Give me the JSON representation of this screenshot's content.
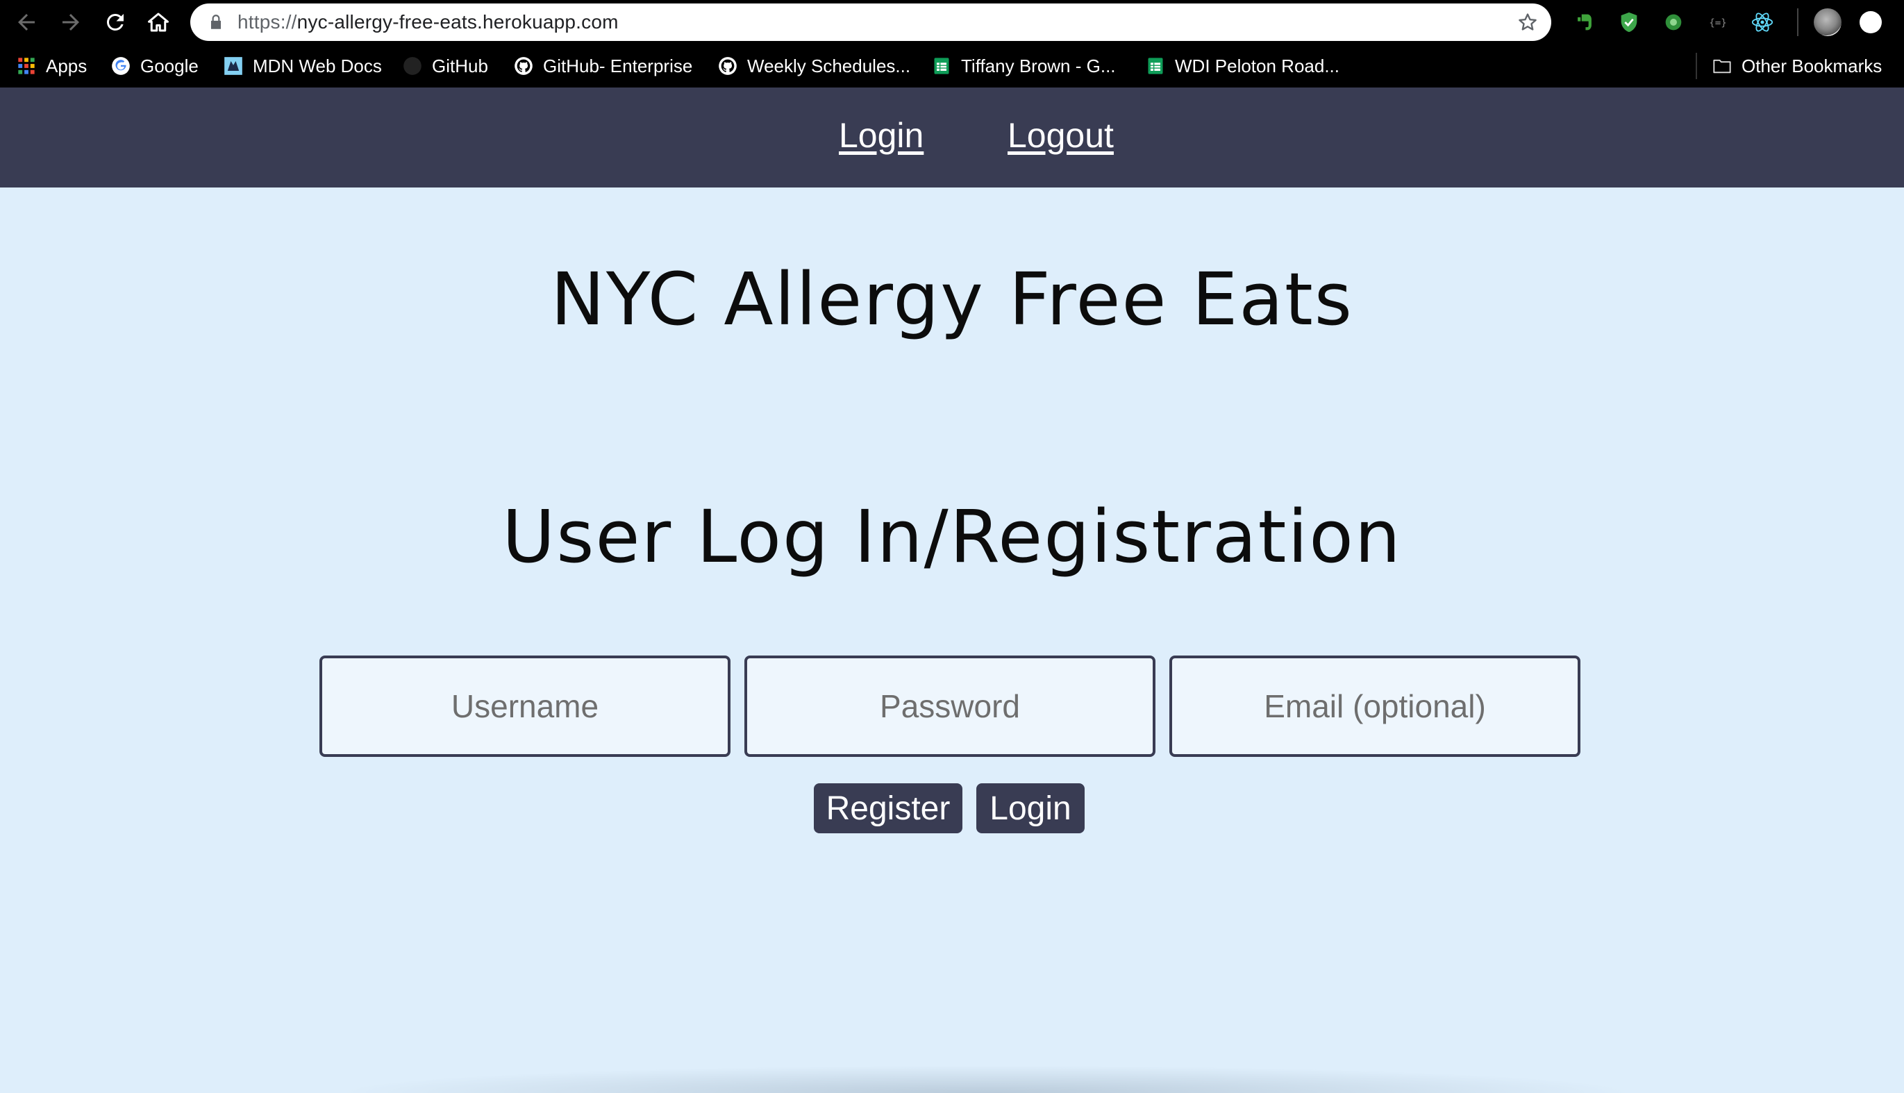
{
  "browser": {
    "url_scheme": "https://",
    "url_host": "nyc-allergy-free-eats.herokuapp.com",
    "bookmarks": [
      {
        "label": "Apps",
        "icon": "apps-grid-icon"
      },
      {
        "label": "Google",
        "icon": "google-icon"
      },
      {
        "label": "MDN Web Docs",
        "icon": "mdn-icon"
      },
      {
        "label": "GitHub",
        "icon": "github-icon"
      },
      {
        "label": "GitHub- Enterprise",
        "icon": "github-icon"
      },
      {
        "label": "Weekly Schedules...",
        "icon": "github-icon"
      },
      {
        "label": "Tiffany Brown - G...",
        "icon": "sheets-icon"
      },
      {
        "label": "WDI Peloton Road...",
        "icon": "sheets-icon"
      }
    ],
    "other_bookmarks": "Other Bookmarks",
    "extensions": [
      "evernote-icon",
      "shield-check-icon",
      "grammar-icon",
      "json-viewer-icon",
      "react-devtools-icon"
    ]
  },
  "site_nav": {
    "login": "Login",
    "logout": "Logout"
  },
  "page": {
    "site_title": "NYC Allergy Free Eats",
    "section_title": "User Log In/Registration",
    "fields": {
      "username_placeholder": "Username",
      "password_placeholder": "Password",
      "email_placeholder": "Email (optional)"
    },
    "buttons": {
      "register": "Register",
      "login": "Login"
    }
  },
  "colors": {
    "nav_bg": "#393c53",
    "page_bg": "#deeefb",
    "button_bg": "#393c53"
  }
}
